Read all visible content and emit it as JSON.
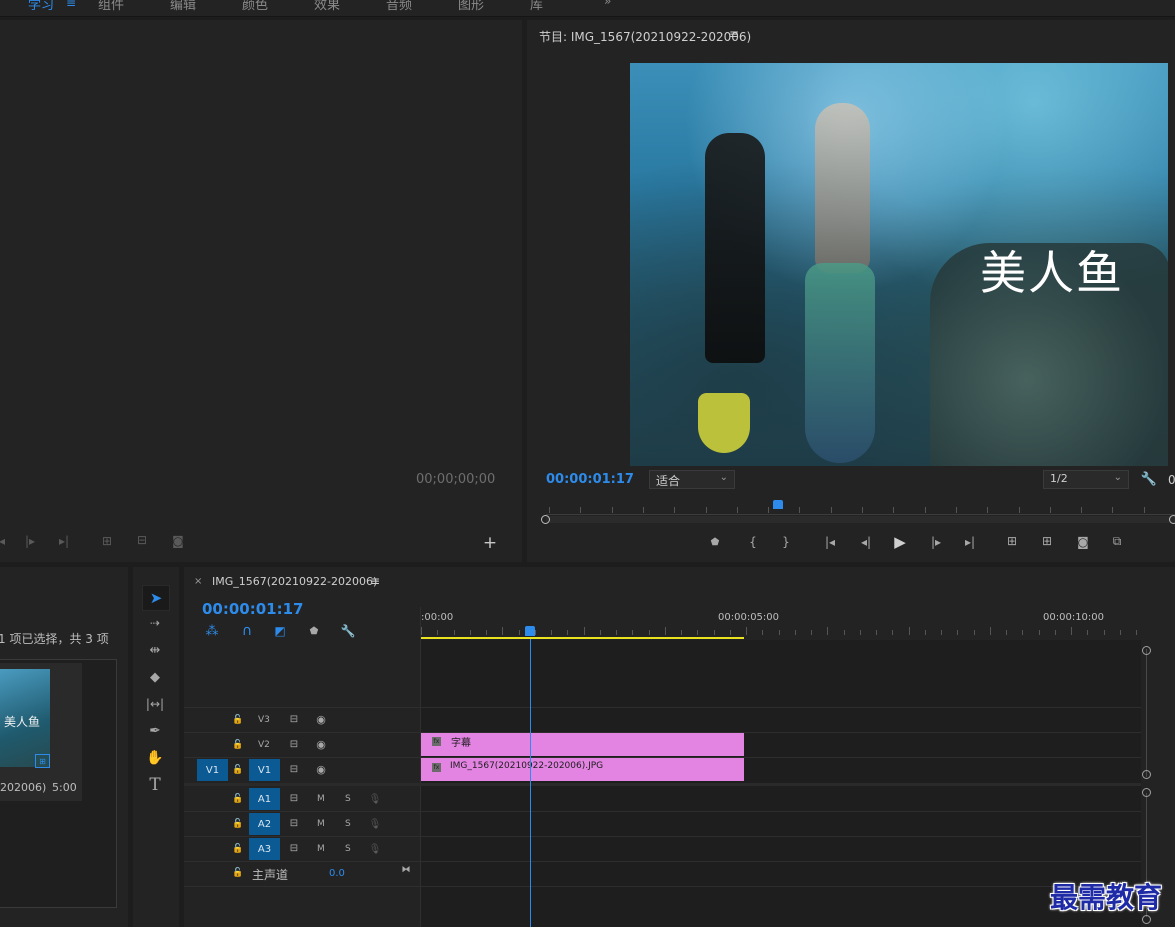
{
  "menu": {
    "items": [
      "学习",
      "组件",
      "编辑",
      "颜色",
      "效果",
      "音频",
      "图形",
      "库"
    ]
  },
  "source": {
    "timecode": "00;00;00;00"
  },
  "program": {
    "title": "节目: IMG_1567(20210922-202006)",
    "overlay_text": "美人鱼",
    "timecode": "00:00:01:17",
    "zoom_select": "适合",
    "resolution_select": "1/2",
    "cut_value": "0"
  },
  "project": {
    "selection_info": "1 项已选择，共 3 项",
    "thumb_text": "美人鱼",
    "clip_name": "202006)",
    "clip_duration": "5:00"
  },
  "timeline": {
    "tab_title": "IMG_1567(20210922-202006)",
    "timecode": "00:00:01:17",
    "ruler": [
      ":00:00",
      "00:00:05:00",
      "00:00:10:00"
    ],
    "video_tracks": [
      {
        "name": "V3",
        "source": ""
      },
      {
        "name": "V2",
        "source": ""
      },
      {
        "name": "V1",
        "source": "V1"
      }
    ],
    "audio_tracks": [
      {
        "name": "A1",
        "m": "M",
        "s": "S"
      },
      {
        "name": "A2",
        "m": "M",
        "s": "S"
      },
      {
        "name": "A3",
        "m": "M",
        "s": "S"
      }
    ],
    "master_label": "主声道",
    "master_value": "0.0",
    "clips": [
      {
        "label": "字幕",
        "track": "V2",
        "color": "#e383e2"
      },
      {
        "label": "IMG_1567(20210922-202006).JPG",
        "track": "V1",
        "color": "#e383e2"
      }
    ]
  },
  "watermark": "最需教育",
  "colors": {
    "accent": "#2d8ceb",
    "clip": "#e383e2",
    "track_target": "#0b5a93",
    "work_area": "#e9e21f"
  }
}
